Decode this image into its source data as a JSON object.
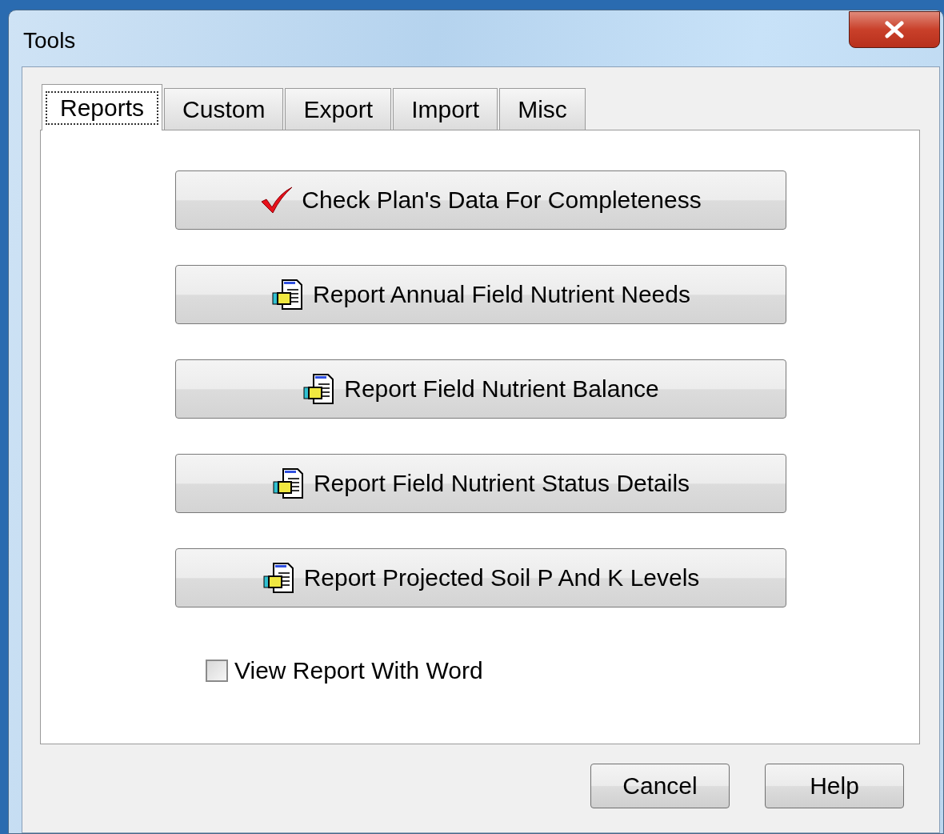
{
  "window": {
    "title": "Tools"
  },
  "tabs": [
    {
      "label": "Reports",
      "selected": true
    },
    {
      "label": "Custom",
      "selected": false
    },
    {
      "label": "Export",
      "selected": false
    },
    {
      "label": "Import",
      "selected": false
    },
    {
      "label": "Misc",
      "selected": false
    }
  ],
  "actions": [
    {
      "label": "Check Plan's Data For Completeness",
      "kind": "check"
    },
    {
      "label": "Report Annual Field Nutrient Needs",
      "kind": "report"
    },
    {
      "label": "Report Field Nutrient Balance",
      "kind": "report"
    },
    {
      "label": "Report Field Nutrient Status Details",
      "kind": "report"
    },
    {
      "label": "Report Projected Soil P And K Levels",
      "kind": "report"
    }
  ],
  "option": {
    "label": "View Report With Word",
    "checked": false
  },
  "buttons": [
    "Cancel",
    "Help"
  ]
}
